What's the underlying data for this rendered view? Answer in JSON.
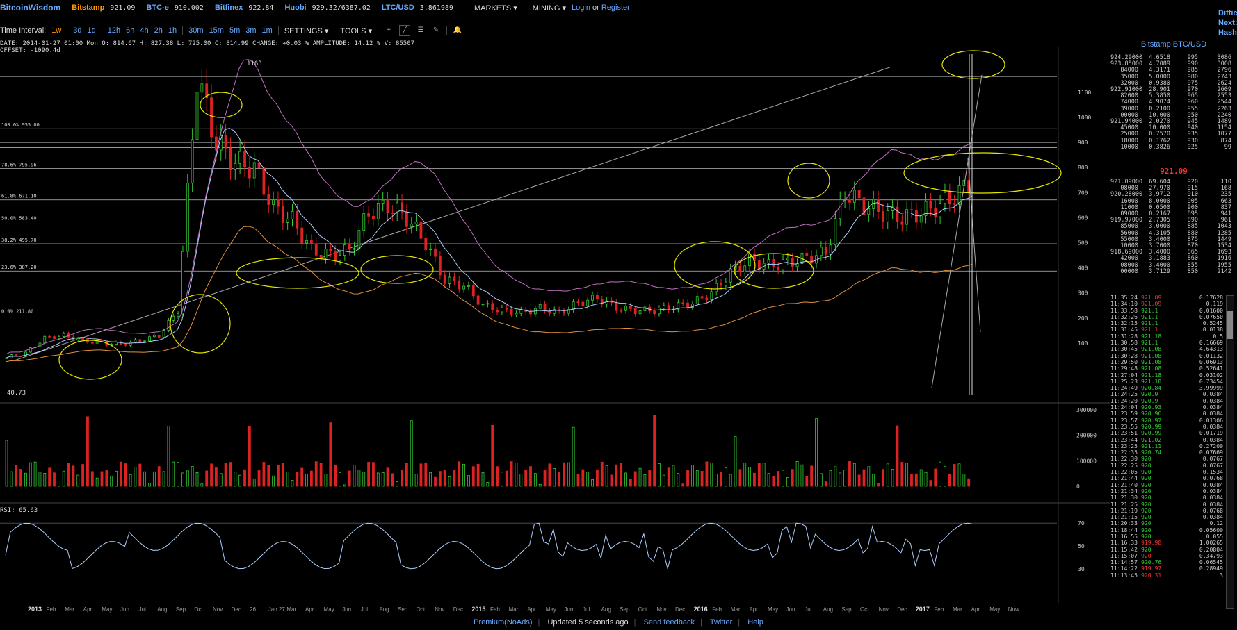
{
  "topbar": {
    "logo": "BitcoinWisdom",
    "tickers": [
      {
        "exchange": "Bitstamp",
        "price": "921.09"
      },
      {
        "exchange": "BTC-e",
        "price": "910.002"
      },
      {
        "exchange": "Bitfinex",
        "price": "922.84"
      },
      {
        "exchange": "Huobi",
        "price": "929.32/6387.02"
      },
      {
        "exchange": "LTC/USD",
        "price": "3.861989"
      }
    ],
    "markets": "MARKETS",
    "mining": "MINING",
    "login": "Login",
    "or": "or",
    "register": "Register"
  },
  "difficulty": [
    "Diffic",
    "Next:",
    "Hash"
  ],
  "toolbar": {
    "label": "Time Interval:",
    "intervals": [
      "1w",
      "3d",
      "1d",
      "12h",
      "6h",
      "4h",
      "2h",
      "1h",
      "30m",
      "15m",
      "5m",
      "3m",
      "1m"
    ],
    "active": "1w",
    "settings": "SETTINGS",
    "tools": "TOOLS",
    "tool_icons": [
      "crosshair-icon",
      "trendline-icon",
      "horizontal-lines-icon",
      "pencil-icon",
      "alert-bell-icon"
    ]
  },
  "ohlc": {
    "line1": "DATE: 2014-01-27 01:00 Mon    O: 814.67    H: 827.38    L: 725.00    C: 814.99    CHANGE: +0.03 %    AMPLITUDE: 14.12 %    V: 85507",
    "line2": "OFFSET: -1090.4d"
  },
  "chart_labels": {
    "peak": "1163",
    "start": "40.73",
    "rsi": "RSI: 65.63",
    "fib": [
      {
        "label": "100.0% 955.00",
        "price": 955
      },
      {
        "label": "78.6% 795.96",
        "price": 795.96
      },
      {
        "label": "61.8% 671.10",
        "price": 671.1
      },
      {
        "label": "50.0% 583.40",
        "price": 583.4
      },
      {
        "label": "38.2% 495.70",
        "price": 495.7
      },
      {
        "label": "23.6% 387.20",
        "price": 387.2
      },
      {
        "label": "0.0% 211.80",
        "price": 211.8
      }
    ],
    "price_ticks": [
      "1100",
      "1000",
      "900",
      "800",
      "700",
      "600",
      "500",
      "400",
      "300",
      "200",
      "100"
    ],
    "volume_ticks": [
      "300000",
      "200000",
      "100000",
      "0"
    ],
    "rsi_ticks": [
      "70",
      "50",
      "30"
    ],
    "x_ticks": [
      "2013",
      "Feb",
      "Mar",
      "Apr",
      "May",
      "Jun",
      "Jul",
      "Aug",
      "Sep",
      "Oct",
      "Nov",
      "Dec",
      "26",
      "Jan 27",
      "Mar",
      "Apr",
      "May",
      "Jun",
      "Jul",
      "Aug",
      "Sep",
      "Oct",
      "Nov",
      "Dec",
      "2015",
      "Feb",
      "Mar",
      "Apr",
      "May",
      "Jun",
      "Jul",
      "Aug",
      "Sep",
      "Oct",
      "Nov",
      "Dec",
      "2016",
      "Feb",
      "Mar",
      "Apr",
      "May",
      "Jun",
      "Jul",
      "Aug",
      "Sep",
      "Oct",
      "Nov",
      "Dec",
      "2017",
      "Feb",
      "Mar",
      "Apr",
      "May",
      "Now"
    ]
  },
  "chart_data": {
    "type": "line",
    "series": [
      {
        "values": [
          40.73,
          60,
          120,
          130,
          110,
          100,
          95,
          110,
          130,
          230,
          1163,
          900,
          820,
          800,
          640,
          590,
          470,
          450,
          470,
          620,
          650,
          600,
          500,
          350,
          330,
          250,
          230,
          220,
          240,
          220,
          260,
          280,
          240,
          230,
          230,
          245,
          260,
          300,
          380,
          430,
          410,
          420,
          440,
          460,
          700,
          650,
          620,
          600,
          620,
          650,
          700,
          780,
          1000,
          921.09
        ]
      }
    ],
    "ylim": [
      0,
      1200
    ]
  },
  "orderbook": {
    "title": "Bitstamp BTC/USD",
    "asks": [
      [
        "924.29000",
        "4.6518",
        "995",
        "3086"
      ],
      [
        "923.85000",
        "4.7089",
        "990",
        "3008"
      ],
      [
        "84000",
        "4.3171",
        "985",
        "2796"
      ],
      [
        "35000",
        "5.0000",
        "980",
        "2743"
      ],
      [
        "32000",
        "0.9380",
        "975",
        "2624"
      ],
      [
        "922.91000",
        "28.901",
        "970",
        "2609"
      ],
      [
        "82000",
        "5.3850",
        "965",
        "2553"
      ],
      [
        "74000",
        "4.9074",
        "960",
        "2544"
      ],
      [
        "39000",
        "0.2100",
        "955",
        "2263"
      ],
      [
        "00000",
        "10.000",
        "950",
        "2240"
      ],
      [
        "921.94000",
        "2.0270",
        "945",
        "1489"
      ],
      [
        "45000",
        "10.000",
        "940",
        "1154"
      ],
      [
        "25000",
        "0.7570",
        "935",
        "1077"
      ],
      [
        "18000",
        "0.1762",
        "930",
        "874"
      ],
      [
        "10000",
        "0.3826",
        "925",
        "99"
      ]
    ],
    "last": "921.09",
    "bids": [
      [
        "921.09000",
        "69.604",
        "920",
        "110"
      ],
      [
        "08000",
        "27.970",
        "915",
        "168"
      ],
      [
        "920.28000",
        "3.9712",
        "910",
        "235"
      ],
      [
        "16000",
        "8.0000",
        "905",
        "663"
      ],
      [
        "11000",
        "0.0500",
        "900",
        "837"
      ],
      [
        "09000",
        "0.2167",
        "895",
        "941"
      ],
      [
        "919.97000",
        "2.7305",
        "890",
        "961"
      ],
      [
        "85000",
        "3.0000",
        "885",
        "1043"
      ],
      [
        "56000",
        "4.3105",
        "880",
        "1285"
      ],
      [
        "55000",
        "3.4000",
        "875",
        "1449"
      ],
      [
        "10000",
        "3.7000",
        "870",
        "1534"
      ],
      [
        "918.69000",
        "3.4000",
        "865",
        "1693"
      ],
      [
        "42000",
        "3.1883",
        "860",
        "1916"
      ],
      [
        "08000",
        "3.4000",
        "855",
        "1955"
      ],
      [
        "00000",
        "3.7129",
        "850",
        "2142"
      ]
    ]
  },
  "trades": [
    [
      "11:35:24",
      "921.09",
      "0.17628",
      "red"
    ],
    [
      "11:34:10",
      "921.09",
      "0.119",
      "red"
    ],
    [
      "11:33:58",
      "921.1",
      "0.01600",
      "green"
    ],
    [
      "11:32:26",
      "921.1",
      "0.07650",
      "green"
    ],
    [
      "11:32:15",
      "921.1",
      "0.5245",
      "green"
    ],
    [
      "11:31:45",
      "921.1",
      "0.0138",
      "red"
    ],
    [
      "11:31:28",
      "921.18",
      "0.5",
      "green"
    ],
    [
      "11:30:58",
      "921.1",
      "0.16669",
      "green"
    ],
    [
      "11:30:45",
      "921.08",
      "4.64313",
      "green"
    ],
    [
      "11:30:28",
      "921.08",
      "0.01132",
      "green"
    ],
    [
      "11:29:50",
      "921.08",
      "0.06913",
      "green"
    ],
    [
      "11:29:48",
      "921.08",
      "0.52641",
      "green"
    ],
    [
      "11:27:04",
      "921.18",
      "0.03102",
      "green"
    ],
    [
      "11:25:23",
      "921.18",
      "0.73454",
      "green"
    ],
    [
      "11:24:49",
      "920.84",
      "3.99999",
      "green"
    ],
    [
      "11:24:25",
      "920.9",
      "0.0384",
      "green"
    ],
    [
      "11:24:20",
      "920.9",
      "0.0384",
      "green"
    ],
    [
      "11:24:04",
      "920.93",
      "0.0384",
      "green"
    ],
    [
      "11:23:59",
      "920.96",
      "0.0384",
      "green"
    ],
    [
      "11:23:57",
      "920.97",
      "0.01306",
      "green"
    ],
    [
      "11:23:55",
      "920.99",
      "0.0384",
      "green"
    ],
    [
      "11:23:51",
      "920.99",
      "0.01719",
      "green"
    ],
    [
      "11:23:44",
      "921.02",
      "0.0384",
      "green"
    ],
    [
      "11:23:25",
      "921.11",
      "0.27200",
      "green"
    ],
    [
      "11:22:35",
      "920.74",
      "0.07669",
      "green"
    ],
    [
      "11:22:30",
      "920",
      "0.0767",
      "green"
    ],
    [
      "11:22:25",
      "920",
      "0.0767",
      "green"
    ],
    [
      "11:22:05",
      "920",
      "0.1534",
      "green"
    ],
    [
      "11:21:44",
      "920",
      "0.0768",
      "green"
    ],
    [
      "11:21:40",
      "920",
      "0.0384",
      "green"
    ],
    [
      "11:21:34",
      "920",
      "0.0384",
      "green"
    ],
    [
      "11:21:30",
      "920",
      "0.0384",
      "green"
    ],
    [
      "11:21:25",
      "920",
      "0.0384",
      "green"
    ],
    [
      "11:21:19",
      "920",
      "0.0768",
      "green"
    ],
    [
      "11:21:15",
      "920",
      "0.0384",
      "green"
    ],
    [
      "11:20:33",
      "920",
      "0.12",
      "green"
    ],
    [
      "11:18:44",
      "920",
      "0.05600",
      "green"
    ],
    [
      "11:16:55",
      "920",
      "0.055",
      "green"
    ],
    [
      "11:16:33",
      "919.98",
      "1.00265",
      "red"
    ],
    [
      "11:15:42",
      "920",
      "0.20804",
      "green"
    ],
    [
      "11:15:07",
      "920",
      "0.34793",
      "red"
    ],
    [
      "11:14:57",
      "920.76",
      "0.06545",
      "green"
    ],
    [
      "11:14:22",
      "919.97",
      "0.28949",
      "red"
    ],
    [
      "11:13:45",
      "920.31",
      "3",
      "red"
    ]
  ],
  "footer": {
    "premium": "Premium(NoAds)",
    "updated": "Updated 5 seconds ago",
    "feedback": "Send feedback",
    "twitter": "Twitter",
    "help": "Help"
  },
  "colors": {
    "up": "#33cc33",
    "down": "#dd2222",
    "annotation": "#e6e600",
    "ma_fast": "#b0d0ff",
    "band_upper": "#c070c0",
    "band_lower": "#e09040",
    "link": "#66aaff"
  }
}
